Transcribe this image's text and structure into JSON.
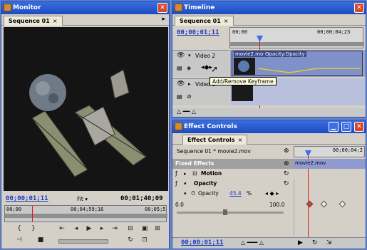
{
  "monitor": {
    "title": "Monitor",
    "tab": "Sequence 01",
    "tab_close": "×",
    "timecode_current": "00;00;01;11",
    "fit_label": "Fit",
    "timecode_duration": "00;01;40;09",
    "ruler_labels": [
      "00;00",
      "00;04;59;16",
      "00;05;5"
    ]
  },
  "timeline": {
    "title": "Timeline",
    "tab": "Sequence 01",
    "tab_close": "×",
    "timecode": "00;00;01;11",
    "ruler_labels": [
      "00;00",
      "00;00;04;23"
    ],
    "track_video2": "Video 2",
    "clip_name": "movie2.mov",
    "clip_effect": "Opacity:Opacity",
    "track_video1": "Video 1",
    "tooltip": "Add/Remove Keyframe"
  },
  "effect_controls": {
    "title": "Effect Controls",
    "tab": "Effect Controls",
    "tab_close": "×",
    "sequence_label": "Sequence 01 * movie2.mov",
    "ruler_label": "00;00;04;2",
    "clip_bar_label": "movie2.mov",
    "fixed_effects": "Fixed Effects",
    "motion": "Motion",
    "opacity_group": "Opacity",
    "opacity_prop": "Opacity",
    "opacity_value": "45.4",
    "opacity_value_suffix": "%",
    "slider_min": "0.0",
    "slider_max": "100.0",
    "opacity_fraction": 0.454,
    "timecode": "00;00;01;11"
  },
  "icons": [
    "eye-icon",
    "speaker-icon",
    "lock-icon",
    "keyframe-nav-icon",
    "play-icon",
    "stop-icon",
    "step-back-icon",
    "step-forward-icon",
    "reset-icon",
    "zoom-slider-icon"
  ],
  "colors": {
    "title_blue": "#1d4bc0",
    "panel_gray": "#d4d0c8",
    "timecode_blue": "#1f3bbf",
    "playhead_red": "#e01818",
    "clip_blue": "#8090c8"
  }
}
